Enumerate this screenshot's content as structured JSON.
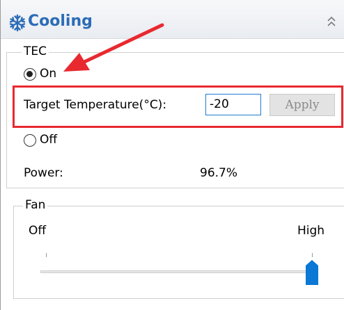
{
  "panel": {
    "title": "Cooling",
    "icon": "snowflake-icon",
    "accent_color": "#2b6cb7"
  },
  "tec": {
    "legend": "TEC",
    "on_label": "On",
    "off_label": "Off",
    "selected": "On",
    "target_label": "Target Temperature(°C):",
    "target_value": "-20",
    "apply_label": "Apply",
    "power_label": "Power:",
    "power_value": "96.7%"
  },
  "fan": {
    "legend": "Fan",
    "min_label": "Off",
    "max_label": "High",
    "level_fraction": 1.0
  },
  "annotation": {
    "color": "#e8292f"
  }
}
